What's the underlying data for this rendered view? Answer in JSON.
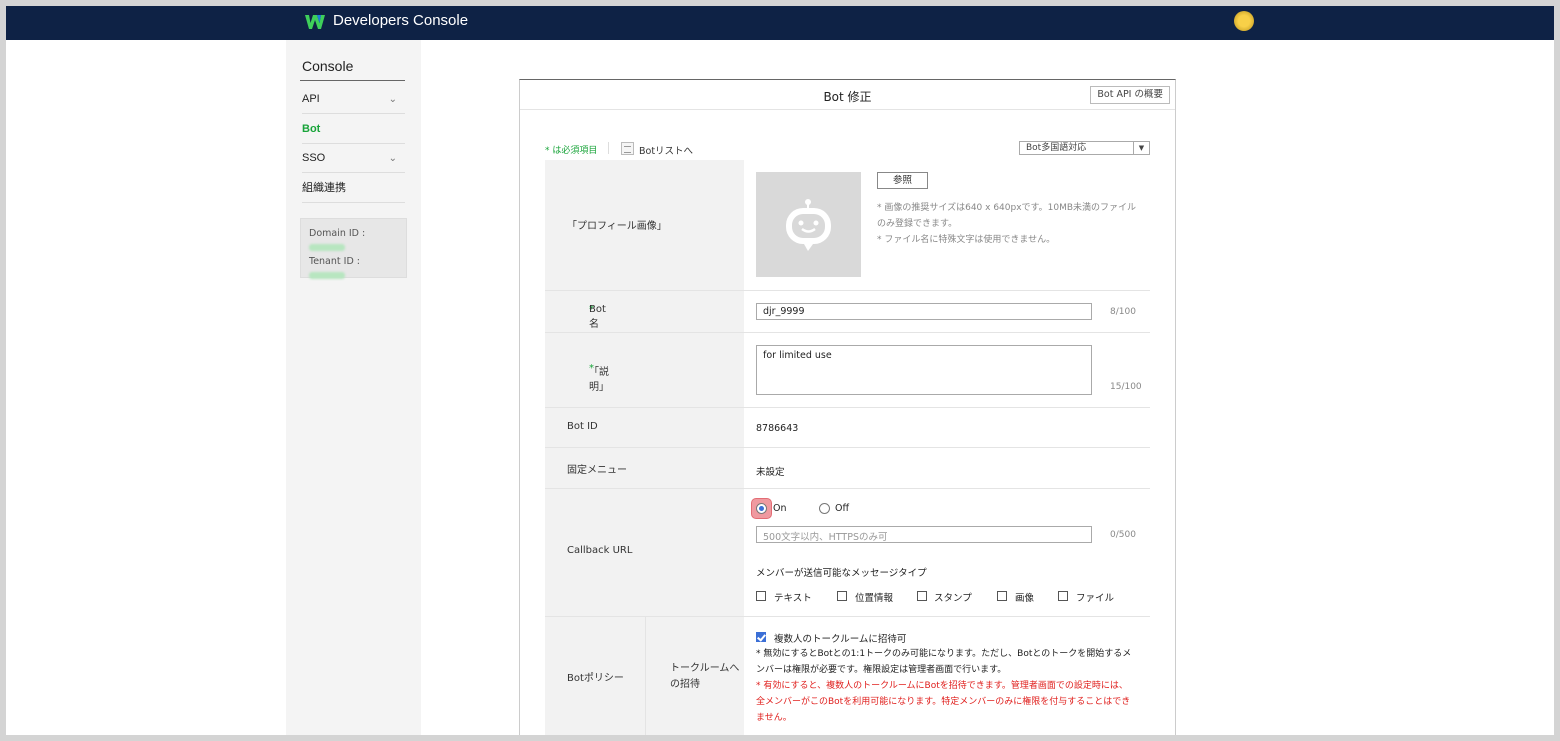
{
  "header": {
    "brand": "Developers Console",
    "logo_icon": "works-w-logo",
    "colors": {
      "topbar": "#0e2245",
      "accent_green": "#19a43a",
      "warning_red": "#e0201e"
    }
  },
  "sidebar": {
    "title": "Console",
    "items": [
      {
        "label": "API",
        "has_chevron": true
      },
      {
        "label": "Bot",
        "active": true
      },
      {
        "label": "SSO",
        "has_chevron": true
      },
      {
        "label": "組織連携"
      }
    ],
    "domain_id_label": "Domain ID :",
    "tenant_id_label": "Tenant ID :"
  },
  "panel": {
    "title": "Bot 修正",
    "api_overview_button": "Bot API の概要",
    "required_note": "* は必須項目",
    "bot_list_link": "Botリストへ",
    "language_select": "Bot多国語対応"
  },
  "form": {
    "profile_image": {
      "label": "「プロフィール画像」",
      "ref_button": "参照",
      "note_1": "* 画像の推奨サイズは640 x 640pxです。10MB未満のファイルのみ登録できます。",
      "note_2": "* ファイル名に特殊文字は使用できません。"
    },
    "bot_name": {
      "label": "Bot名",
      "value": "djr_9999",
      "counter": "8/100"
    },
    "description": {
      "label": "「説明」",
      "value": "for limited use",
      "counter": "15/100"
    },
    "bot_id": {
      "label": "Bot ID",
      "value": "8786643"
    },
    "fixed_menu": {
      "label": "固定メニュー",
      "value": "未設定"
    },
    "callback_url": {
      "label": "Callback URL",
      "on_label": "On",
      "off_label": "Off",
      "selected": "On",
      "url_value": "",
      "url_placeholder": "500文字以内、HTTPSのみ可",
      "counter": "0/500",
      "message_types_title": "メンバーが送信可能なメッセージタイプ",
      "message_types": [
        "テキスト",
        "位置情報",
        "スタンプ",
        "画像",
        "ファイル"
      ]
    },
    "bot_policy": {
      "label": "Botポリシー",
      "sub_label": "トークルームへの招待",
      "checkbox_label": "複数人のトークルームに招待可",
      "checked": true,
      "note_1": "* 無効にするとBotとの1:1トークのみ可能になります。ただし、Botとのトークを開始するメンバーは権限が必要です。権限設定は管理者画面で行います。",
      "warning": "* 有効にすると、複数人のトークルームにBotを招待できます。管理者画面での設定時には、全メンバーがこのBotを利用可能になります。特定メンバーのみに権限を付与することはできません。"
    }
  }
}
